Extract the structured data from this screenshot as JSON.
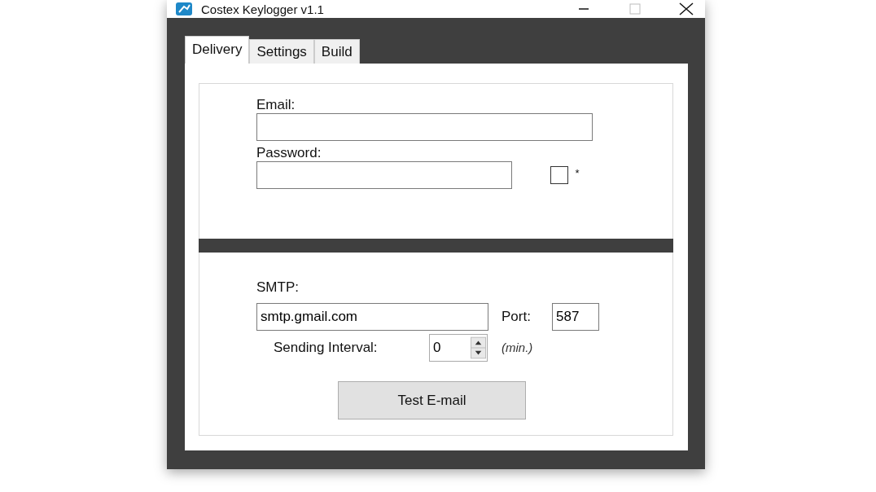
{
  "window": {
    "title": "Costex Keylogger v1.1"
  },
  "tabs": [
    {
      "label": "Delivery",
      "selected": true
    },
    {
      "label": "Settings",
      "selected": false
    },
    {
      "label": "Build",
      "selected": false
    }
  ],
  "account": {
    "email_label": "Email:",
    "password_label": "Password:",
    "show_password": {
      "label": "*",
      "checked": false
    }
  },
  "smtp": {
    "label": "SMTP:",
    "server": "smtp.gmail.com",
    "port_label": "Port:",
    "port": "587",
    "interval_label": "Sending Interval:",
    "interval": "0",
    "interval_unit": "(min.)"
  },
  "buttons": [
    {
      "label": "Test E-mail"
    }
  ]
}
